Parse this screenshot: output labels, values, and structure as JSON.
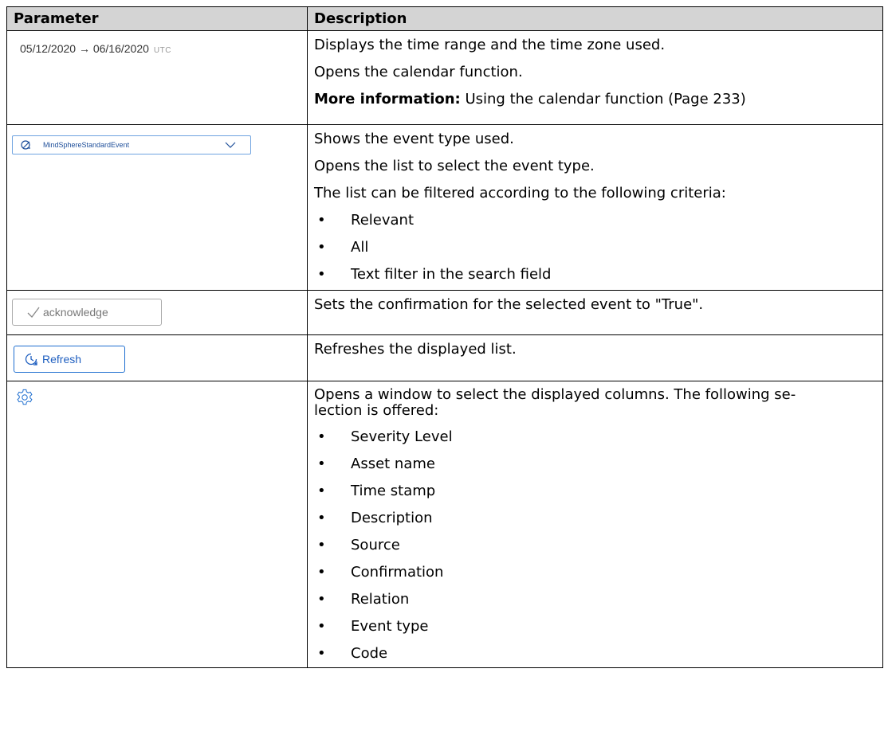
{
  "table": {
    "headers": [
      "Parameter",
      "Description"
    ]
  },
  "rows": {
    "date": {
      "range": "05/12/2020 → 06/16/2020",
      "tz": "UTC",
      "desc": [
        "Displays the time range and the time zone used.",
        "Opens the calendar function."
      ],
      "more_label": "More information:",
      "more_text": " Using the calendar function (Page 233)"
    },
    "event": {
      "select_label": "MindSphereStandardEvent",
      "desc": [
        "Shows the event type used.",
        "Opens the list to select the event type.",
        "The list can be filtered according to the following criteria:"
      ],
      "bullets": [
        "Relevant",
        "All",
        "Text filter in the search field"
      ]
    },
    "ack": {
      "button_label": "acknowledge",
      "desc": "Sets the confirmation for the selected event to \"True\"."
    },
    "refresh": {
      "button_label": "Refresh",
      "desc": "Refreshes the displayed list."
    },
    "settings": {
      "icon": "gear-icon",
      "desc": "Opens a window to select the displayed columns. The following se-\nlection is offered:",
      "bullets": [
        "Severity Level",
        "Asset name",
        "Time stamp",
        "Description",
        "Source",
        "Confirmation",
        "Relation",
        "Event type",
        "Code"
      ]
    }
  },
  "colors": {
    "header_bg": "#d4d4d4",
    "accent": "#1f6fd0"
  }
}
